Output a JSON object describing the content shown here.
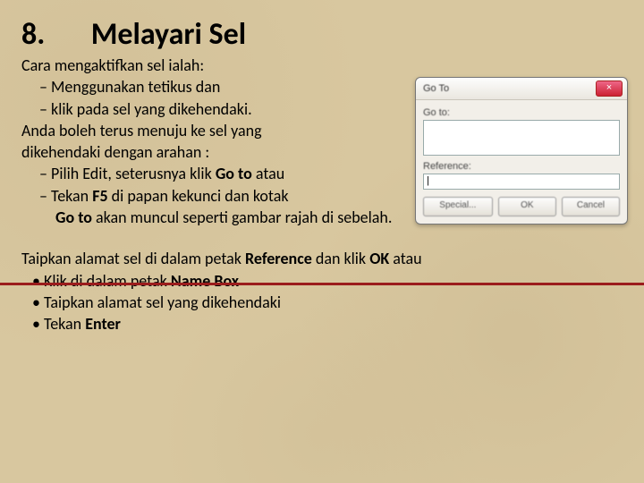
{
  "heading_num": "8.",
  "heading_title": "Melayari Sel",
  "line1": "Cara mengaktifkan sel ialah:",
  "li1a": "Menggunakan tetikus dan",
  "li1b": "klik pada sel yang dikehendaki.",
  "line2a": "Anda boleh terus menuju ke sel yang",
  "line2b": "dikehendaki dengan arahan :",
  "li2a_pre": "Pilih Edit, seterusnya klik ",
  "li2a_b": "Go to",
  "li2a_post": " atau",
  "li2b_pre": "Tekan ",
  "li2b_b": "F5",
  "li2b_post": " di papan kekunci dan kotak",
  "line3_pre": "",
  "line3_b": "Go to",
  "line3_post": " akan muncul seperti gambar rajah di sebelah.",
  "after1_pre": "Taipkan alamat sel di dalam petak ",
  "after1_b1": "Reference",
  "after1_mid": " dan klik ",
  "after1_b2": "OK",
  "after1_post": " atau",
  "b1_pre": "Klik di dalam petak ",
  "b1_b": "Name Box",
  "b2": "Taipkan alamat sel yang dikehendaki",
  "b3_pre": "Tekan ",
  "b3_b": "Enter",
  "dialog": {
    "title": "Go To",
    "close": "×",
    "goto_label": "Go to:",
    "ref_label": "Reference:",
    "ref_value": "|",
    "special": "Special...",
    "ok": "OK",
    "cancel": "Cancel"
  }
}
